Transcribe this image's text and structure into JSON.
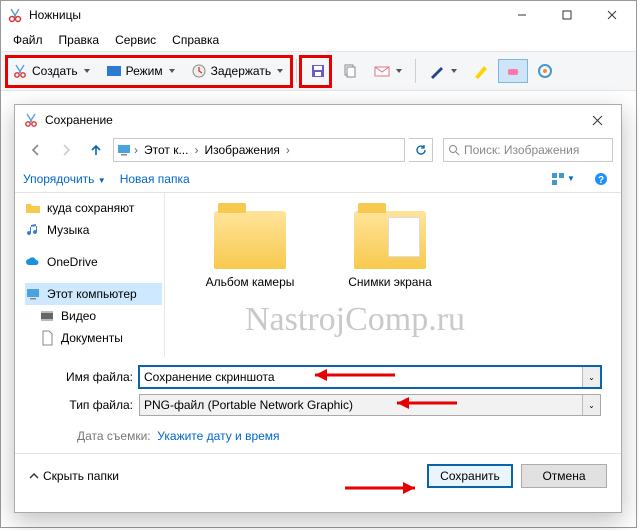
{
  "window": {
    "title": "Ножницы",
    "menu": {
      "file": "Файл",
      "edit": "Правка",
      "tools": "Сервис",
      "help": "Справка"
    },
    "toolbar": {
      "create": "Создать",
      "mode": "Режим",
      "delay": "Задержать"
    }
  },
  "dialog": {
    "title": "Сохранение",
    "breadcrumb": {
      "pc": "Этот к...",
      "folder": "Изображения"
    },
    "search_placeholder": "Поиск: Изображения",
    "organize": "Упорядочить",
    "newfolder": "Новая папка",
    "sidebar": {
      "saveto": "куда сохраняют",
      "music": "Музыка",
      "onedrive": "OneDrive",
      "thispc": "Этот компьютер",
      "video": "Видео",
      "documents": "Документы"
    },
    "folders": {
      "camera": "Альбом камеры",
      "screenshots": "Снимки экрана"
    },
    "watermark": "NastrojComp.ru",
    "labels": {
      "filename": "Имя файла:",
      "filetype": "Тип файла:",
      "date": "Дата съемки:"
    },
    "filename_value": "Сохранение скриншота",
    "filetype_value": "PNG-файл (Portable Network Graphic)",
    "date_link": "Укажите дату и время",
    "hide_folders": "Скрыть папки",
    "save": "Сохранить",
    "cancel": "Отмена"
  }
}
